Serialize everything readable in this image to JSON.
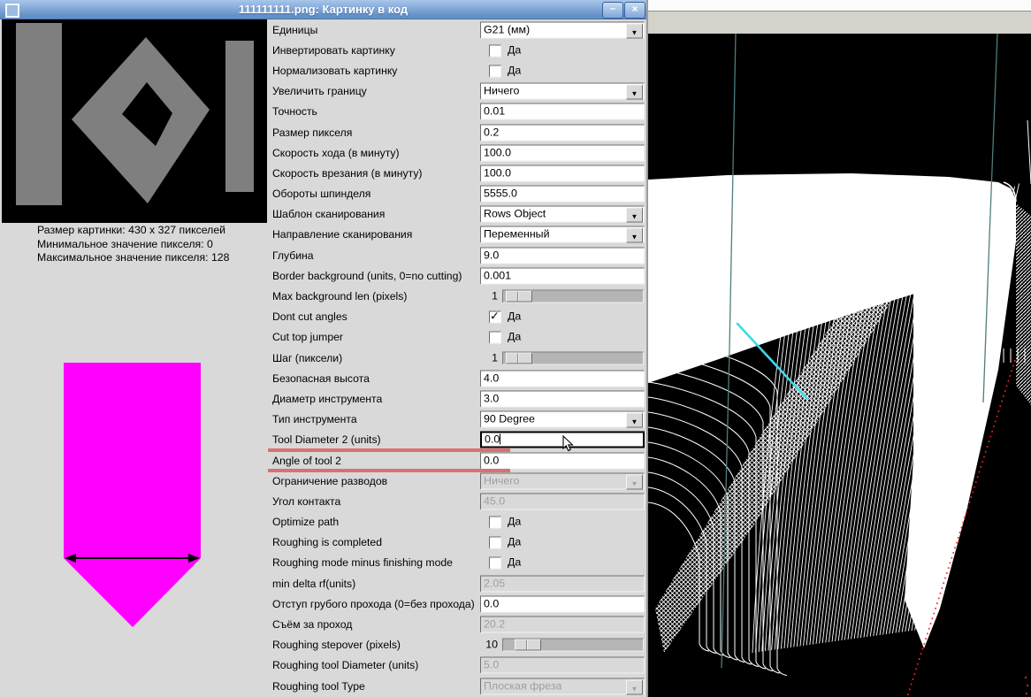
{
  "window": {
    "title": "111111111.png: Картинку в код",
    "minimize_label": "–",
    "close_label": "×"
  },
  "preview": {
    "info_lines": [
      "Размер картинки: 430 x 327 пикселей",
      "Минимальное значение пикселя: 0",
      "Максимальное значение пикселя: 128"
    ]
  },
  "form": {
    "rows": [
      {
        "name": "units",
        "label": "Единицы",
        "widget": "select",
        "value": "G21 (мм)"
      },
      {
        "name": "invert-image",
        "label": "Инвертировать картинку",
        "widget": "checkbox",
        "value": "Да",
        "checked": false
      },
      {
        "name": "normalize-image",
        "label": "Нормализовать картинку",
        "widget": "checkbox",
        "value": "Да",
        "checked": false
      },
      {
        "name": "extend-border",
        "label": "Увеличить границу",
        "widget": "select",
        "value": "Ничего"
      },
      {
        "name": "tolerance",
        "label": "Точность",
        "widget": "entry",
        "value": "0.01"
      },
      {
        "name": "pixel-size",
        "label": "Размер пикселя",
        "widget": "entry",
        "value": "0.2"
      },
      {
        "name": "feed-rate",
        "label": "Скорость хода (в минуту)",
        "widget": "entry",
        "value": "100.0"
      },
      {
        "name": "plunge-rate",
        "label": "Скорость врезания (в минуту)",
        "widget": "entry",
        "value": "100.0"
      },
      {
        "name": "spindle-speed",
        "label": "Обороты шпинделя",
        "widget": "entry",
        "value": "5555.0"
      },
      {
        "name": "scan-pattern",
        "label": "Шаблон сканирования",
        "widget": "select",
        "value": "Rows Object"
      },
      {
        "name": "scan-direction",
        "label": "Направление сканирования",
        "widget": "select",
        "value": "Переменный"
      },
      {
        "name": "depth",
        "label": "Глубина",
        "widget": "entry",
        "value": "9.0"
      },
      {
        "name": "border-background",
        "label": "Border background (units, 0=no cutting)",
        "widget": "entry",
        "value": "0.001"
      },
      {
        "name": "max-background-len",
        "label": "Max background len (pixels)",
        "widget": "slider",
        "value": "1",
        "slider_pos": 0.02
      },
      {
        "name": "dont-cut-angles",
        "label": "Dont cut angles",
        "widget": "checkbox",
        "value": "Да",
        "checked": true
      },
      {
        "name": "cut-top-jumper",
        "label": "Cut top jumper",
        "widget": "checkbox",
        "value": "Да",
        "checked": false
      },
      {
        "name": "step-pixels",
        "label": "Шаг (пиксели)",
        "widget": "slider",
        "value": "1",
        "slider_pos": 0.02
      },
      {
        "name": "safety-height",
        "label": "Безопасная высота",
        "widget": "entry",
        "value": "4.0"
      },
      {
        "name": "tool-diameter",
        "label": "Диаметр инструмента",
        "widget": "entry",
        "value": "3.0"
      },
      {
        "name": "tool-type",
        "label": "Тип инструмента",
        "widget": "select",
        "value": "90 Degree"
      },
      {
        "name": "tool-diameter-2",
        "label": "Tool Diameter 2 (units)",
        "widget": "entry",
        "value": "0.0",
        "focused": true,
        "underline": true
      },
      {
        "name": "angle-of-tool-2",
        "label": "Angle of tool 2",
        "widget": "entry",
        "value": "0.0",
        "underline": true
      },
      {
        "name": "lace-bounding",
        "label": "Ограничение разводов",
        "widget": "select",
        "value": "Ничего",
        "disabled": true
      },
      {
        "name": "contact-angle",
        "label": "Угол контакта",
        "widget": "entry",
        "value": "45.0",
        "disabled": true
      },
      {
        "name": "optimize-path",
        "label": "Optimize path",
        "widget": "checkbox",
        "value": "Да",
        "checked": false
      },
      {
        "name": "roughing-is-completed",
        "label": "Roughing is completed",
        "widget": "checkbox",
        "value": "Да",
        "checked": false
      },
      {
        "name": "roughing-minus-finishing",
        "label": "Roughing mode minus finishing mode",
        "widget": "checkbox",
        "value": "Да",
        "checked": false
      },
      {
        "name": "min-delta-rf",
        "label": "min delta rf(units)",
        "widget": "entry",
        "value": "2.05",
        "disabled": true
      },
      {
        "name": "roughing-offset",
        "label": "Отступ грубого прохода (0=без прохода)",
        "widget": "entry",
        "value": "0.0"
      },
      {
        "name": "depth-per-pass",
        "label": "Съём за проход",
        "widget": "entry",
        "value": "20.2",
        "disabled": true
      },
      {
        "name": "roughing-stepover",
        "label": "Roughing stepover (pixels)",
        "widget": "slider",
        "value": "10",
        "slider_pos": 0.1
      },
      {
        "name": "roughing-tool-diameter",
        "label": "Roughing tool Diameter (units)",
        "widget": "entry",
        "value": "5.0",
        "disabled": true
      },
      {
        "name": "roughing-tool-type",
        "label": "Roughing tool Type",
        "widget": "select",
        "value": "Плоская фреза",
        "disabled": true
      }
    ]
  },
  "colors": {
    "titlebar_top": "#a8c6ea",
    "titlebar_bottom": "#6390c8",
    "form_bg": "#d9d9d9",
    "entry_bg": "#ffffff",
    "disabled_text": "#9e9e9e",
    "annot": "#d97170",
    "preview_gray": "#7f7f7f",
    "tool_magenta": "#ff00ff",
    "teal": "#4e7d7d",
    "cyan": "#3fd9e8",
    "red": "#ff1f1f"
  }
}
